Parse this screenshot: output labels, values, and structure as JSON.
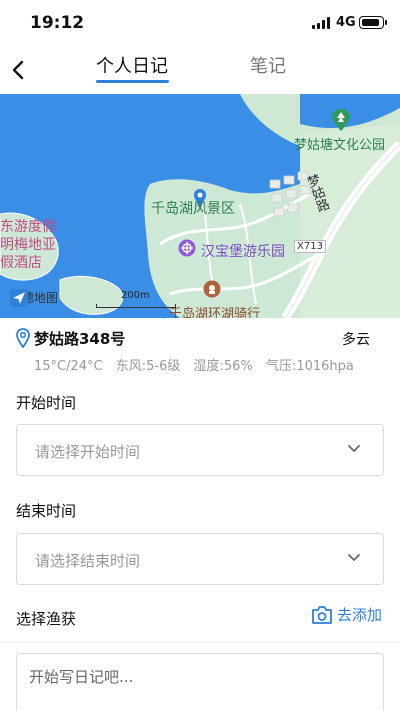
{
  "status_bar": {
    "time": "19:12",
    "network": "4G"
  },
  "header": {
    "tabs": [
      {
        "label": "个人日记",
        "active": true
      },
      {
        "label": "笔记",
        "active": false
      }
    ]
  },
  "map": {
    "labels": {
      "park": "梦姑塘文化公园",
      "scenic": "千岛湖风景区",
      "amusement": "汉宝堡游乐园",
      "cycling": "千岛湖环湖骑行",
      "road_name": "梦姑路",
      "road_code": "X713",
      "resort": [
        "东游度假",
        "明梅地亚",
        "假酒店"
      ]
    },
    "logo": "高德地图",
    "scale": "200m"
  },
  "location": {
    "address": "梦姑路348号",
    "weather": "多云",
    "details": [
      "15°C/24°C",
      "东风:5-6级",
      "湿度:56%",
      "气压:1016hpa"
    ]
  },
  "form": {
    "start_label": "开始时间",
    "start_placeholder": "请选择开始时间",
    "end_label": "结束时间",
    "end_placeholder": "请选择结束时间",
    "catch_label": "选择渔获",
    "add_label": "去添加",
    "diary_placeholder": "开始写日记吧..."
  },
  "colors": {
    "accent": "#2f80d9",
    "water": "#3a8ee6",
    "land": "#cde9d6"
  }
}
